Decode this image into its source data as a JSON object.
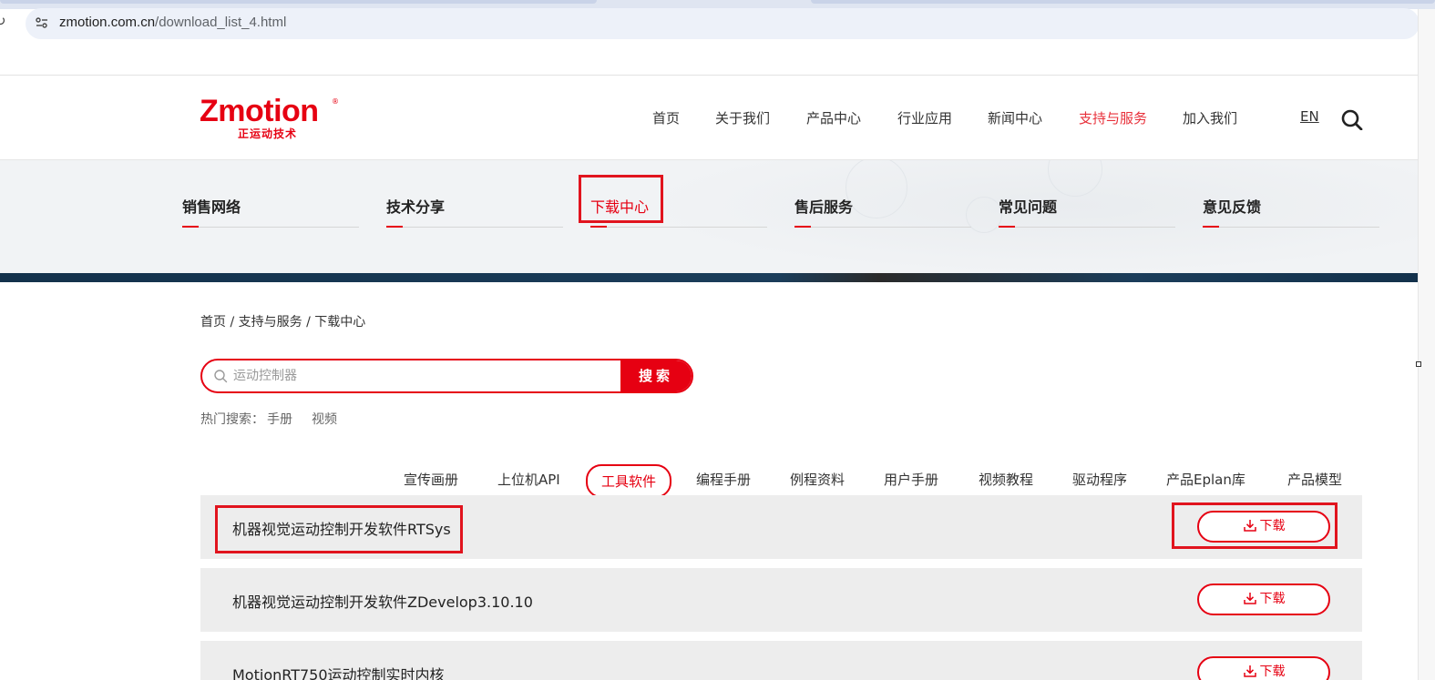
{
  "browser": {
    "url_host": "zmotion.com.cn",
    "url_path": "/download_list_4.html"
  },
  "logo": {
    "main": "Zmotion",
    "reg": "®",
    "sub": "正运动技术"
  },
  "nav": {
    "items": [
      {
        "label": "首页"
      },
      {
        "label": "关于我们"
      },
      {
        "label": "产品中心"
      },
      {
        "label": "行业应用"
      },
      {
        "label": "新闻中心"
      },
      {
        "label": "支持与服务",
        "active": true
      },
      {
        "label": "加入我们"
      }
    ],
    "lang": "EN"
  },
  "subnav": {
    "items": [
      {
        "label": "销售网络"
      },
      {
        "label": "技术分享"
      },
      {
        "label": "下载中心",
        "active": true
      },
      {
        "label": "售后服务"
      },
      {
        "label": "常见问题"
      },
      {
        "label": "意见反馈"
      }
    ]
  },
  "breadcrumb": "首页 / 支持与服务 / 下载中心",
  "search": {
    "placeholder": "运动控制器",
    "button": "搜索",
    "hot_label": "热门搜索：",
    "hot_items": [
      "手册",
      "视频"
    ]
  },
  "categories": [
    {
      "label": "宣传画册"
    },
    {
      "label": "上位机API"
    },
    {
      "label": "工具软件",
      "active": true
    },
    {
      "label": "编程手册"
    },
    {
      "label": "例程资料"
    },
    {
      "label": "用户手册"
    },
    {
      "label": "视频教程"
    },
    {
      "label": "驱动程序"
    },
    {
      "label": "产品Eplan库"
    },
    {
      "label": "产品模型"
    }
  ],
  "downloads": [
    {
      "title": "机器视觉运动控制开发软件RTSys",
      "button": "下载"
    },
    {
      "title": "机器视觉运动控制开发软件ZDevelop3.10.10",
      "button": "下载"
    },
    {
      "title": "MotionRT750运动控制实时内核",
      "button": "下载"
    }
  ],
  "colors": {
    "brand_red": "#e60012",
    "highlight_red": "#e1141e",
    "row_bg": "#ededed"
  }
}
